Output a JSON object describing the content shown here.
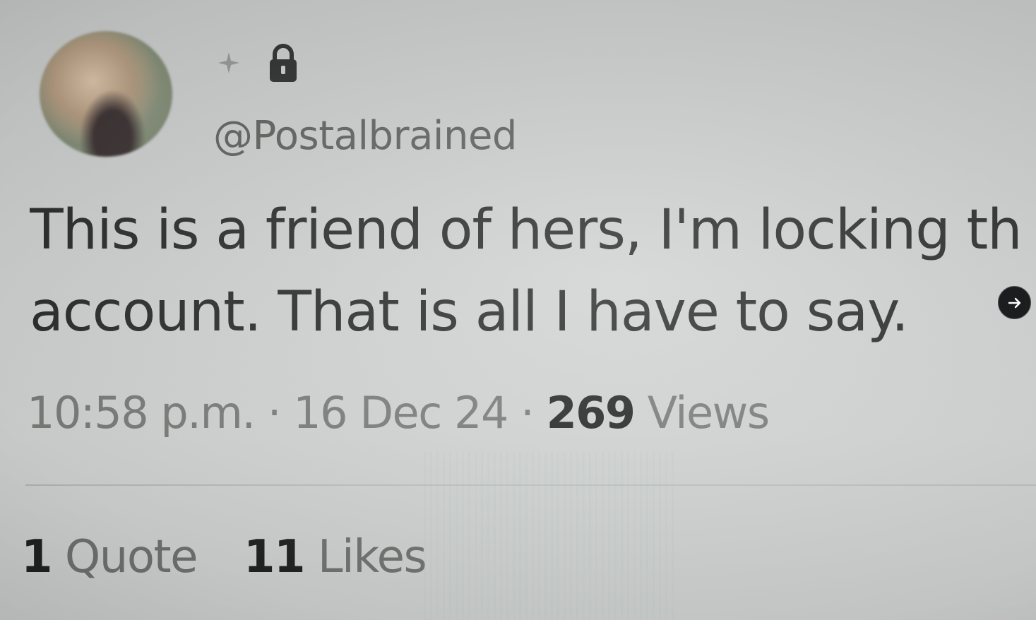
{
  "post": {
    "handle": "@Postalbrained",
    "text_line1": "This is a friend of hers, I'm locking th",
    "text_line2": "account. That is all I have to say.",
    "time": "10:58 p.m.",
    "separator": "·",
    "date": "16 Dec 24",
    "views_count": "269",
    "views_label": "Views",
    "quotes_count": "1",
    "quotes_label": "Quote",
    "likes_count": "11",
    "likes_label": "Likes"
  },
  "icons": {
    "sparkle": "sparkle-icon",
    "lock": "lock-icon",
    "next": "arrow-right-icon"
  },
  "colors": {
    "text": "#2a2d2c",
    "muted": "#7a7e7b",
    "background": "#cfd2d1",
    "next_button": "#1b1d1e"
  }
}
